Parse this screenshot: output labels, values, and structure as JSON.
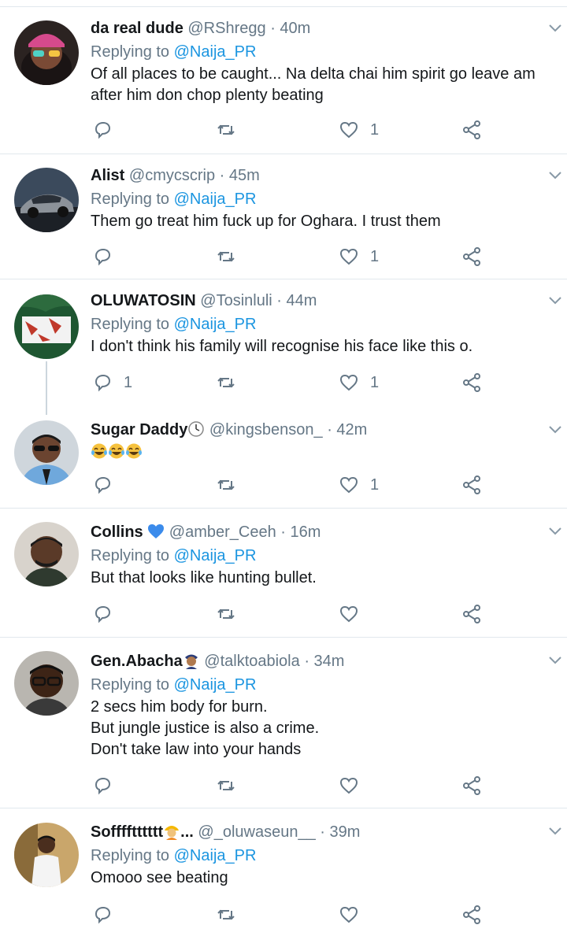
{
  "colors": {
    "name": "#14171a",
    "meta": "#657786",
    "mention": "#1b95e0",
    "divider": "#e1e8ed",
    "icon": "#657786"
  },
  "tweets": [
    {
      "name": "da real dude",
      "handle": "@RShregg",
      "time": "· 40m",
      "replying_prefix": "Replying to ",
      "replying_to": "@Naija_PR",
      "body": "Of all places to be caught... Na delta chai him spirit go leave am\nafter him don chop plenty beating",
      "reply_count": "",
      "retweet_count": "",
      "like_count": "1",
      "avatar": "avatar-pink-beanie"
    },
    {
      "name": "Alist",
      "handle": "@cmycscrip",
      "time": "· 45m",
      "replying_prefix": "Replying to ",
      "replying_to": "@Naija_PR",
      "body": "Them go treat him fuck up for Oghara. I trust them",
      "reply_count": "",
      "retweet_count": "",
      "like_count": "1",
      "avatar": "avatar-car"
    },
    {
      "name": "OLUWATOSIN",
      "handle": "@Tosinluli",
      "time": "· 44m",
      "replying_prefix": "Replying to ",
      "replying_to": "@Naija_PR",
      "body": "I don't think his family will recognise his face like this o.",
      "reply_count": "1",
      "retweet_count": "",
      "like_count": "1",
      "avatar": "avatar-flag"
    },
    {
      "name": "Sugar Daddy",
      "name_emoji": "clock-emoji",
      "handle": "@kingsbenson_",
      "time": "· 42m",
      "replying_prefix": "",
      "replying_to": "",
      "body": "",
      "body_emoji": [
        "laughing-tears-emoji",
        "laughing-tears-emoji",
        "laughing-tears-emoji"
      ],
      "reply_count": "",
      "retweet_count": "",
      "like_count": "1",
      "avatar": "avatar-sunglasses"
    },
    {
      "name": "Collins",
      "name_emoji": "blue-heart-emoji",
      "handle": "@amber_Ceeh",
      "time": "· 16m",
      "replying_prefix": "Replying to ",
      "replying_to": "@Naija_PR",
      "body": "But that looks like hunting bullet.",
      "reply_count": "",
      "retweet_count": "",
      "like_count": "",
      "avatar": "avatar-collins"
    },
    {
      "name": "Gen.Abacha",
      "name_emoji": "police-officer-emoji",
      "handle": "@talktoabiola",
      "time": "· 34m",
      "replying_prefix": "Replying to ",
      "replying_to": "@Naija_PR",
      "body": "2 secs him body for burn.\nBut jungle justice is also a crime.\nDon't take law into your hands",
      "reply_count": "",
      "retweet_count": "",
      "like_count": "",
      "avatar": "avatar-glasses"
    },
    {
      "name": "Sofffftttttt",
      "name_emoji": "construction-worker-emoji",
      "name_suffix": "...",
      "handle": "@_oluwaseun__",
      "time": "· 39m",
      "replying_prefix": "Replying to ",
      "replying_to": "@Naija_PR",
      "body": "Omooo see beating",
      "reply_count": "",
      "retweet_count": "",
      "like_count": "",
      "avatar": "avatar-white-outfit"
    }
  ]
}
